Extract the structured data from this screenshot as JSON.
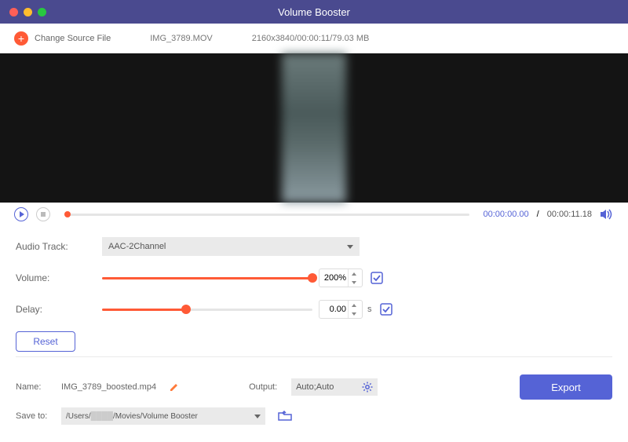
{
  "window": {
    "title": "Volume Booster"
  },
  "toolbar": {
    "change_source": "Change Source File",
    "filename": "IMG_3789.MOV",
    "fileinfo": "2160x3840/00:00:11/79.03 MB"
  },
  "player": {
    "current_time": "00:00:00.00",
    "total_time": "00:00:11.18"
  },
  "controls": {
    "audio_track_label": "Audio Track:",
    "audio_track_value": "AAC-2Channel",
    "volume_label": "Volume:",
    "volume_value": "200%",
    "volume_pct": 100,
    "delay_label": "Delay:",
    "delay_value": "0.00",
    "delay_unit": "s",
    "delay_pct": 40,
    "reset_label": "Reset"
  },
  "footer": {
    "name_label": "Name:",
    "name_value": "IMG_3789_boosted.mp4",
    "output_label": "Output:",
    "output_value": "Auto;Auto",
    "save_to_label": "Save to:",
    "save_path_prefix": "/Users/",
    "save_path_suffix": "/Movies/Volume Booster",
    "export_label": "Export"
  }
}
